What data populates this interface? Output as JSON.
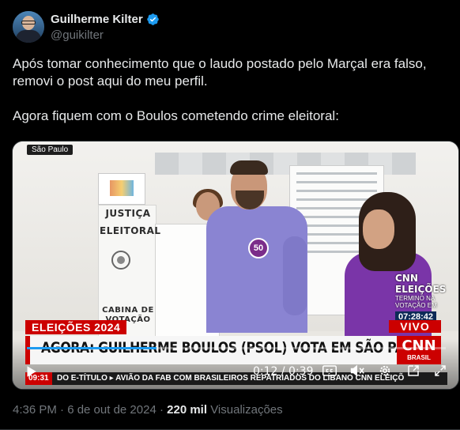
{
  "author": {
    "name": "Guilherme Kilter",
    "handle": "@guikilter",
    "verified_color": "#1d9bf0"
  },
  "tweet": {
    "paragraphs": [
      "Após tomar conhecimento que o laudo postado pelo Marçal era falso, removi o post aqui do meu perfil.",
      "Agora fiquem com o Boulos cometendo crime eleitoral:"
    ]
  },
  "video": {
    "location_tag": "São Paulo",
    "booth_lines": [
      "JUSTIÇA",
      "ELEITORAL",
      "CABINA DE",
      "VOTAÇÃO"
    ],
    "badge_number": "50",
    "bug": {
      "logo": "CNN ELEIÇÕES",
      "sub_line_1": "TERMINO NA",
      "sub_line_2": "VOTAÇÃO EM",
      "clock": "07:28:42"
    },
    "label_left": "ELEIÇÕES 2024",
    "label_right": "VIVO",
    "headline": "AGORA: GUILHERME BOULOS (PSOL) VOTA EM SÃO PAULO",
    "channel_logo": "CNN",
    "channel_sub": "BRASIL",
    "ticker_time": "09:31",
    "ticker_text": "DO E-TÍTULO   ▸ AVIÃO DA FAB COM BRASILEIROS REPATRIADOS DO LÍBANO   CNN ELEIÇÕ",
    "progress_fraction": 0.31,
    "time_display": "0:12 / 0:39",
    "accent_color": "#cc0000"
  },
  "meta": {
    "timestamp": "4:36 PM · 6 de out de 2024 ·",
    "views_count": "220 mil",
    "views_label": "Visualizações"
  }
}
